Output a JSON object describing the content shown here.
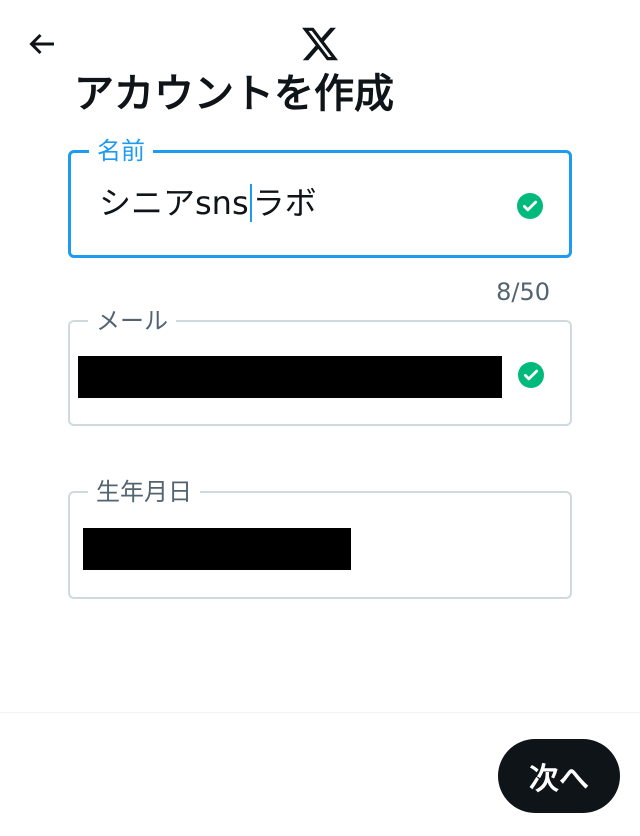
{
  "header": {
    "back_icon": "arrow-left-icon",
    "logo_icon": "x-logo-icon"
  },
  "page": {
    "title": "アカウントを作成"
  },
  "form": {
    "name": {
      "label": "名前",
      "value_before_caret": "シニアsns",
      "value_after_caret": "ラボ",
      "counter": "8/50",
      "valid_icon": "check-circle-icon"
    },
    "email": {
      "label": "メール",
      "valid_icon": "check-circle-icon"
    },
    "birthdate": {
      "label": "生年月日"
    }
  },
  "footer": {
    "next_label": "次へ"
  },
  "colors": {
    "accent": "#1d9bf0",
    "valid": "#00ba7c",
    "border": "#cfd9de",
    "text": "#0f1419",
    "muted": "#536471"
  }
}
